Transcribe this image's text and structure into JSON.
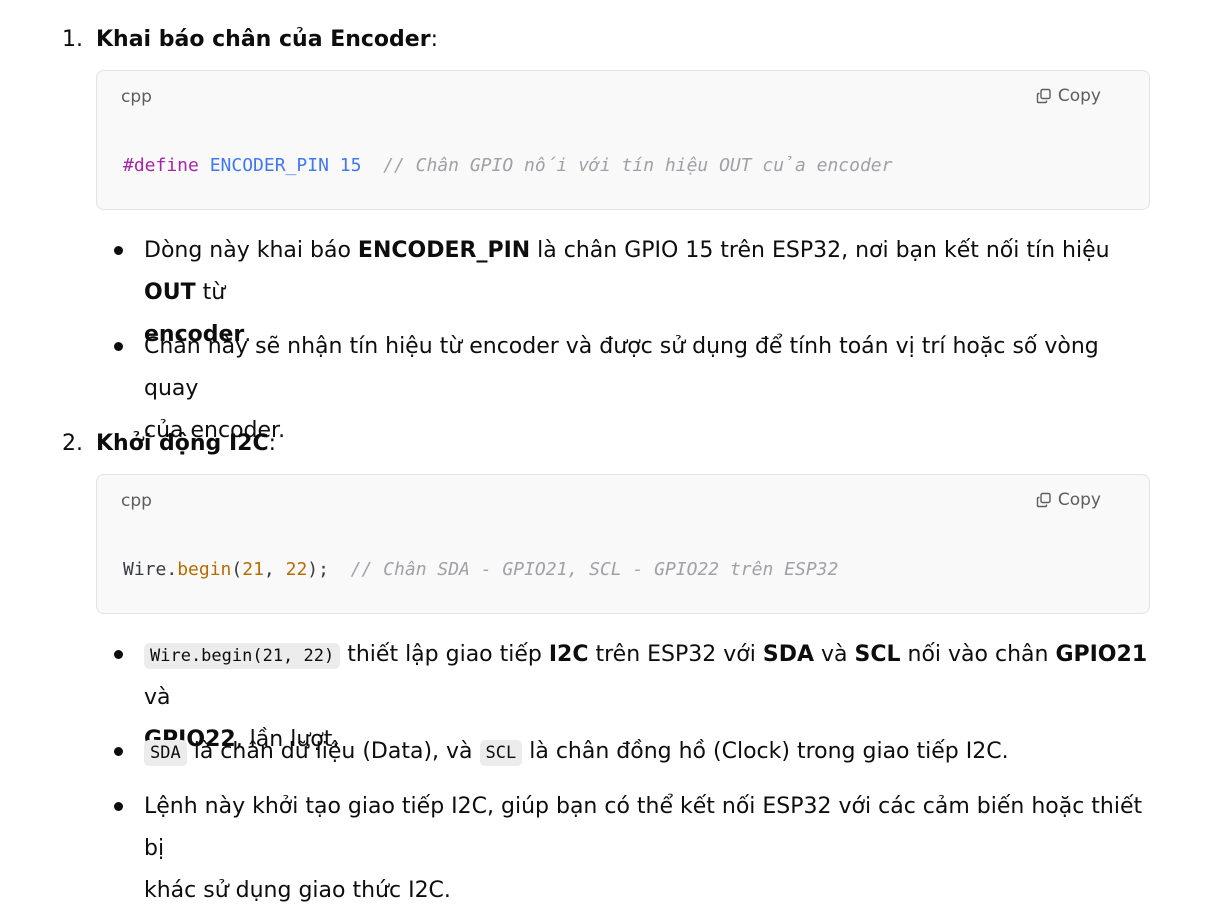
{
  "section1": {
    "number": "1.",
    "title": "Khai báo chân của Encoder",
    "colon": ":",
    "code": {
      "lang": "cpp",
      "copy_label": "Copy",
      "directive": "#define",
      "name": "ENCODER_PIN",
      "value": "15",
      "comment": "// Chân GPIO nối với tín hiệu OUT của encoder"
    },
    "bullets": [
      {
        "t1": "Dòng này khai báo ",
        "b1": "ENCODER_PIN",
        "t2": " là chân GPIO 15 trên ESP32, nơi bạn kết nối tín hiệu ",
        "b2": "OUT",
        "t3": " từ",
        "b3": "encoder",
        "t4": "."
      },
      {
        "line1": "Chân này sẽ nhận tín hiệu từ encoder và được sử dụng để tính toán vị trí hoặc số vòng quay",
        "line2": "của encoder."
      }
    ]
  },
  "section2": {
    "number": "2.",
    "title": "Khởi động I2C",
    "colon": ":",
    "code": {
      "lang": "cpp",
      "copy_label": "Copy",
      "obj": "Wire",
      "dot": ".",
      "method": "begin",
      "open": "(",
      "arg1": "21",
      "sep": ", ",
      "arg2": "22",
      "close": ");",
      "comment": "// Chân SDA - GPIO21, SCL - GPIO22 trên ESP32"
    },
    "bullets": [
      {
        "code": "Wire.begin(21, 22)",
        "t1": " thiết lập giao tiếp ",
        "b1": "I2C",
        "t2": " trên ESP32 với ",
        "b2": "SDA",
        "t3": " và ",
        "b3": "SCL",
        "t4": " nối vào chân ",
        "b4": "GPIO21",
        "t5": " và",
        "b5": "GPIO22",
        "t6": ", lần lượt."
      },
      {
        "code1": "SDA",
        "t1": " là chân dữ liệu (Data), và ",
        "code2": "SCL",
        "t2": " là chân đồng hồ (Clock) trong giao tiếp I2C."
      },
      {
        "line1": "Lệnh này khởi tạo giao tiếp I2C, giúp bạn có thể kết nối ESP32 với các cảm biến hoặc thiết bị",
        "line2": "khác sử dụng giao thức I2C."
      }
    ]
  }
}
